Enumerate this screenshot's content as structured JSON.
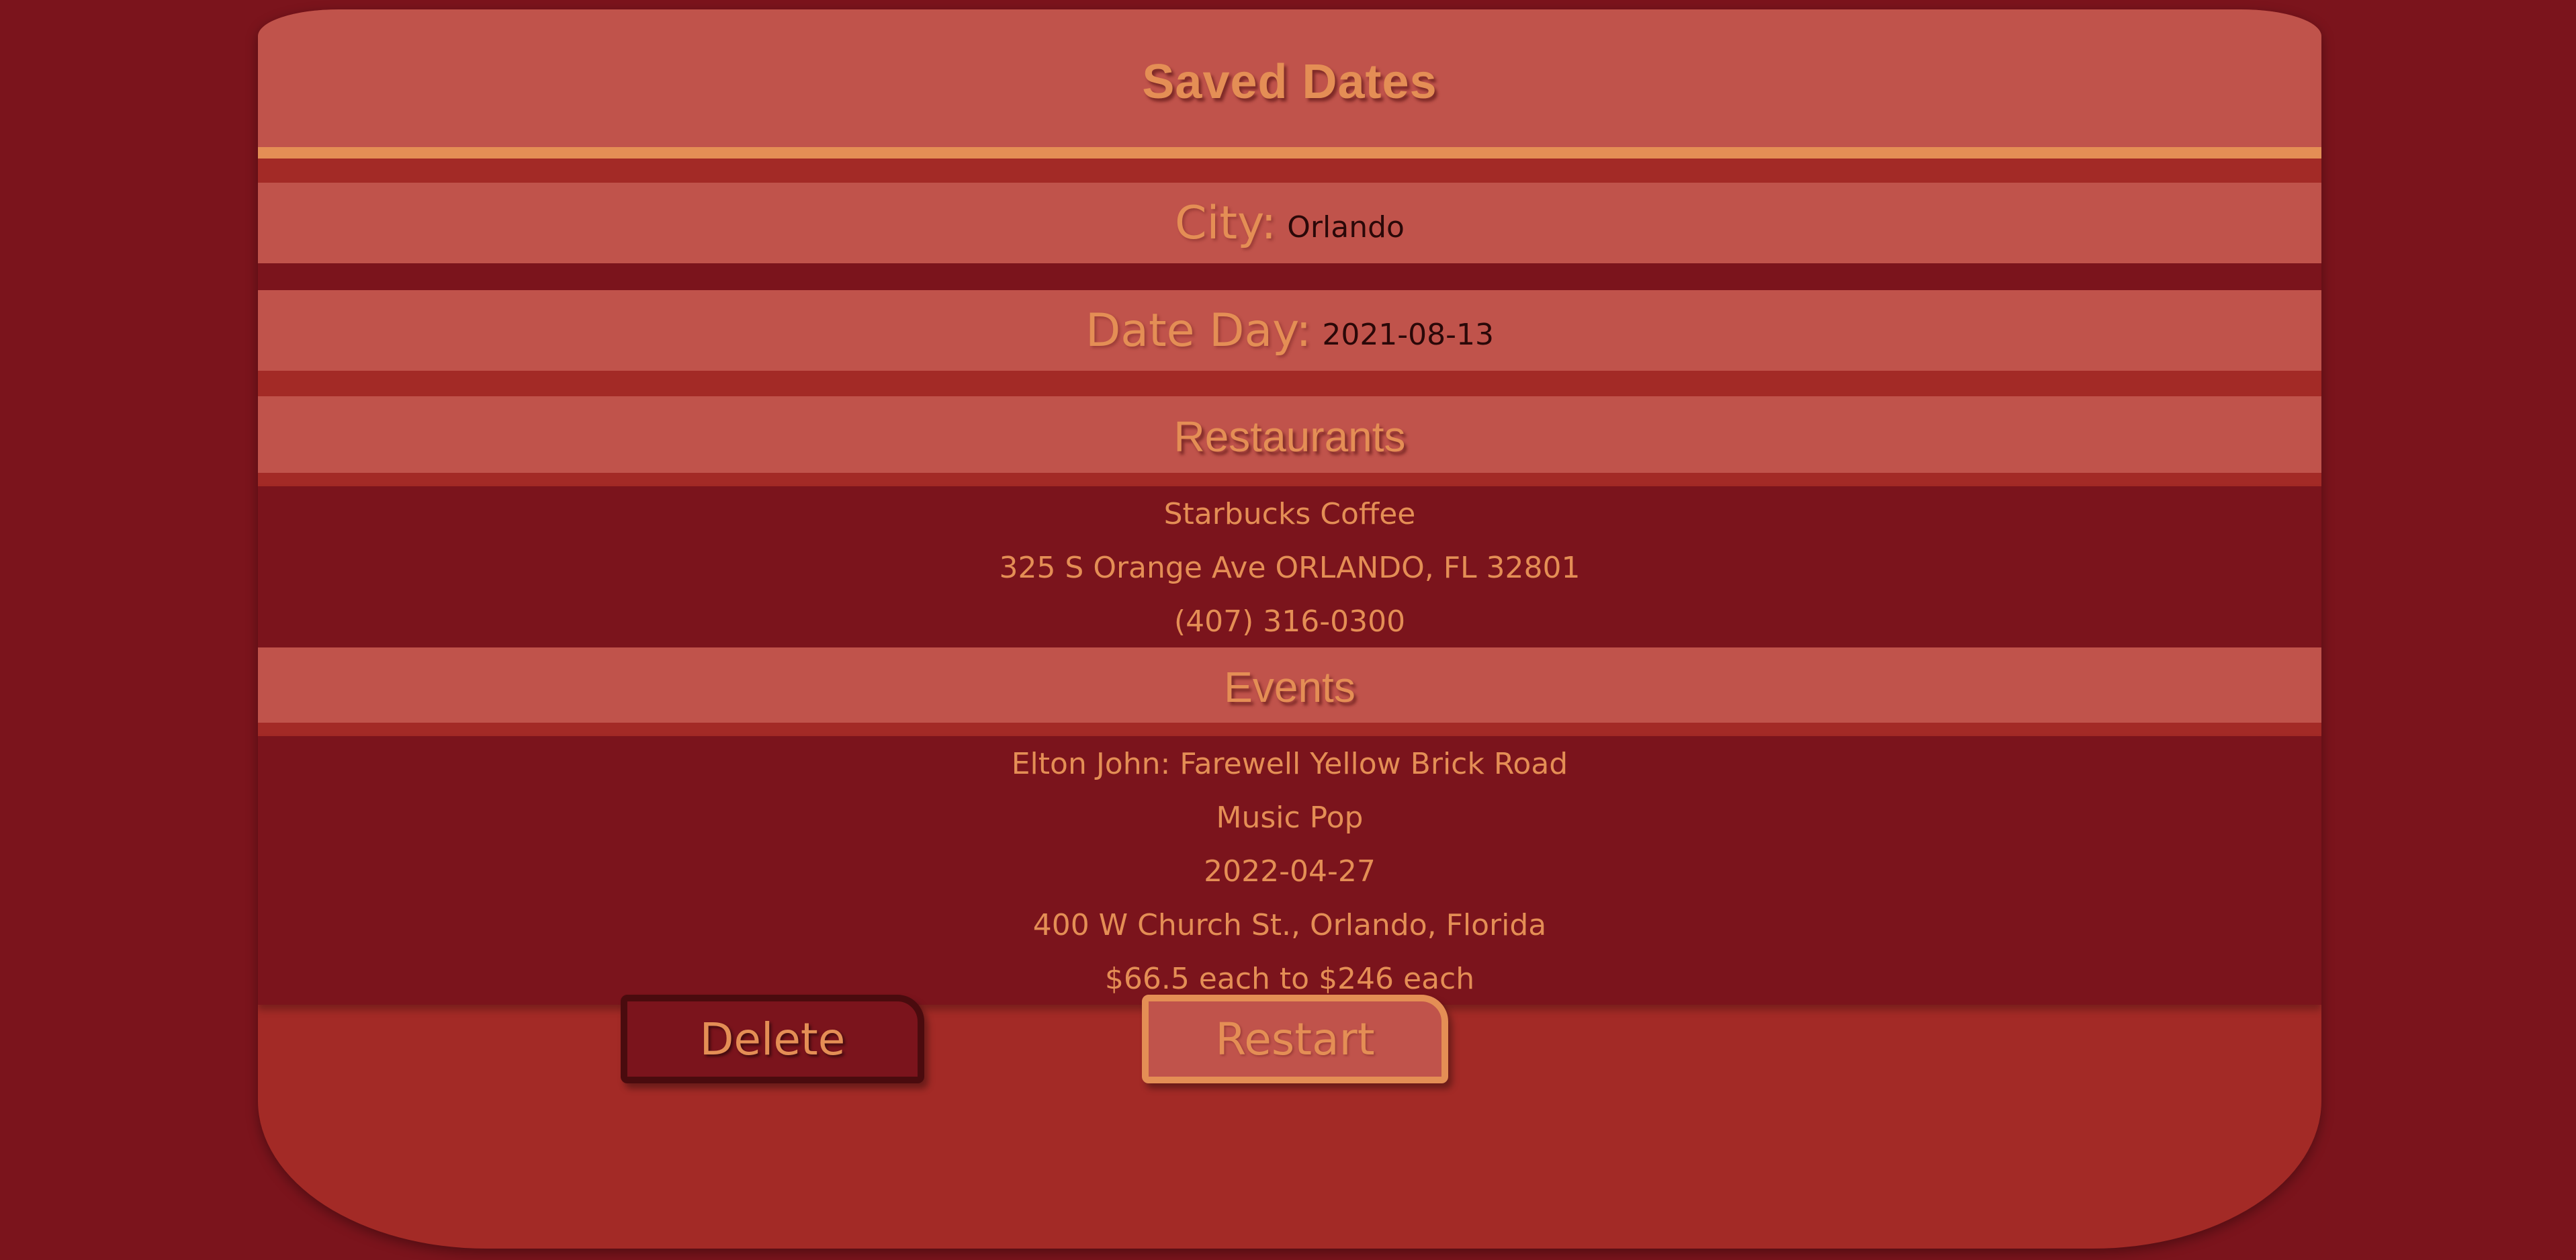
{
  "header": {
    "title": "Saved Dates"
  },
  "fields": {
    "city_label": "City:",
    "city_value": "Orlando",
    "date_label": "Date Day:",
    "date_value": "2021-08-13"
  },
  "restaurants": {
    "title": "Restaurants",
    "name": "Starbucks Coffee",
    "address": "325 S Orange Ave ORLANDO, FL 32801",
    "phone": "(407) 316-0300"
  },
  "events": {
    "title": "Events",
    "name": "Elton John: Farewell Yellow Brick Road",
    "genre": "Music Pop",
    "date": "2022-04-27",
    "address": "400 W Church St., Orlando, Florida",
    "price": "$66.5 each to $246 each"
  },
  "buttons": {
    "delete_label": "Delete",
    "restart_label": "Restart"
  },
  "colors": {
    "background": "#7b141c",
    "card": "#a32a26",
    "panel": "#c0534b",
    "accent": "#e48e55",
    "text_dark": "#2a0808"
  }
}
